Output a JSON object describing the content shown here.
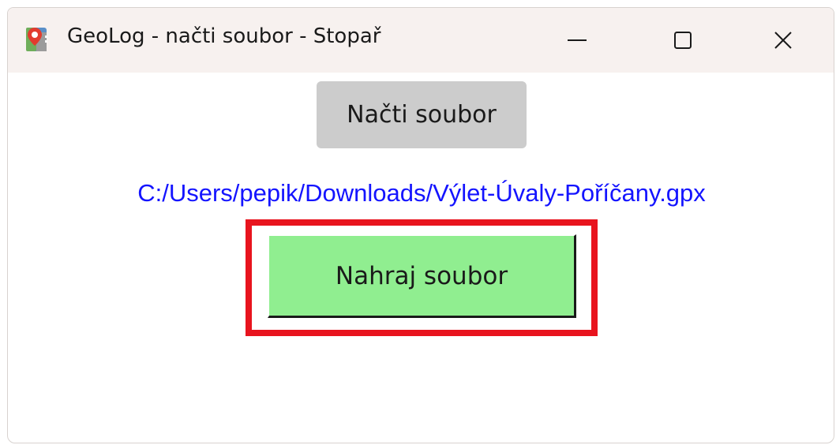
{
  "window": {
    "title": "GeoLog - načti soubor - Stopař",
    "app_icon": "map-pin-icon",
    "controls": {
      "minimize_icon": "minimize-icon",
      "maximize_icon": "maximize-icon",
      "close_icon": "close-icon"
    }
  },
  "main": {
    "load_button_label": "Načti soubor",
    "file_path": "C:/Users/pepik/Downloads/Výlet-Úvaly-Poříčany.gpx",
    "upload_button_label": "Nahraj soubor"
  },
  "colors": {
    "titlebar_bg": "#f7f1ef",
    "load_button_bg": "#cccccc",
    "file_path_text": "#1414ff",
    "upload_button_bg": "#90ee90",
    "highlight_frame": "#e8141e"
  }
}
